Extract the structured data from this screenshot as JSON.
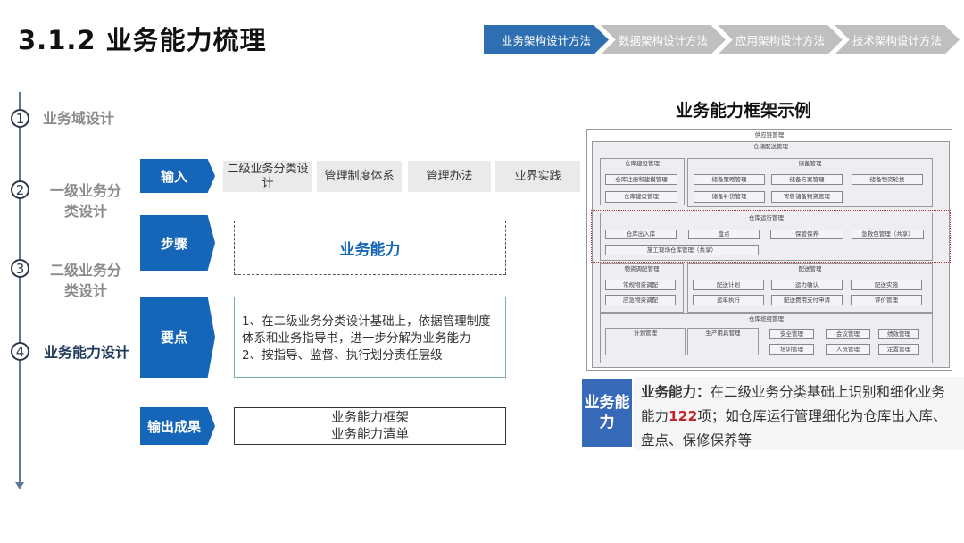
{
  "title": "3.1.2 业务能力梳理",
  "breadcrumbs": [
    "业务架构设计方法",
    "数据架构设计方法",
    "应用架构设计方法",
    "技术架构设计方法"
  ],
  "timeline": [
    {
      "num": "1",
      "label": "业务域设计"
    },
    {
      "num": "2",
      "label": "一级业务分类设计"
    },
    {
      "num": "3",
      "label": "二级业务分类设计"
    },
    {
      "num": "4",
      "label": "业务能力设计"
    }
  ],
  "stages": {
    "input": "输入",
    "steps": "步骤",
    "keypoints": "要点",
    "output": "输出成果"
  },
  "inputs": [
    "二级业务分类设计",
    "管理制度体系",
    "管理办法",
    "业界实践"
  ],
  "step_box": "业务能力",
  "keypoints": [
    "1、在二级业务分类设计基础上，依据管理制度体系和业务指导书，进一步分解为业务能力",
    "2、按指导、监督、执行划分责任层级"
  ],
  "outputs": [
    "业务能力框架",
    "业务能力清单"
  ],
  "framework": {
    "title": "业务能力框架示例",
    "root": "供应链管理",
    "sub": "仓储配送管理",
    "groups": {
      "build": {
        "name": "仓库建设管理",
        "items": [
          "仓库注册和建模管理",
          "仓库建设管理"
        ]
      },
      "reserve": {
        "name": "储备管理",
        "items": [
          "储备策略管理",
          "储备方案管理",
          "储备物资轮换",
          "储备补货管理",
          "寄售储备物资管理"
        ]
      },
      "ops": {
        "name": "仓库运行管理",
        "items": [
          "仓库出入库",
          "盘点",
          "保管保养",
          "急救包管理（共享）",
          "施工现场仓库管理（共享）"
        ]
      },
      "alloc": {
        "name": "物资调配管理",
        "items": [
          "常规物资调配",
          "应急物资调配"
        ]
      },
      "delivery": {
        "name": "配送管理",
        "items": [
          "配送计划",
          "运力确认",
          "配送实施",
          "运单执行",
          "配送费用支付申请",
          "评价管理"
        ]
      },
      "team": {
        "name": "仓库班组管理",
        "items": [
          "计划管理",
          "生产用具管理",
          "安全管理",
          "会议管理",
          "绩效管理",
          "培训管理",
          "人员管理",
          "定置管理"
        ]
      }
    }
  },
  "summary": {
    "tag": "业务能力",
    "label": "业务能力：",
    "text_before": "在二级业务分类基础上识别和细化业务能力",
    "count": "122",
    "text_after": "项；如仓库运行管理细化为仓库出入库、盘点、保修保养等",
    "count_color": "#c0262d"
  }
}
